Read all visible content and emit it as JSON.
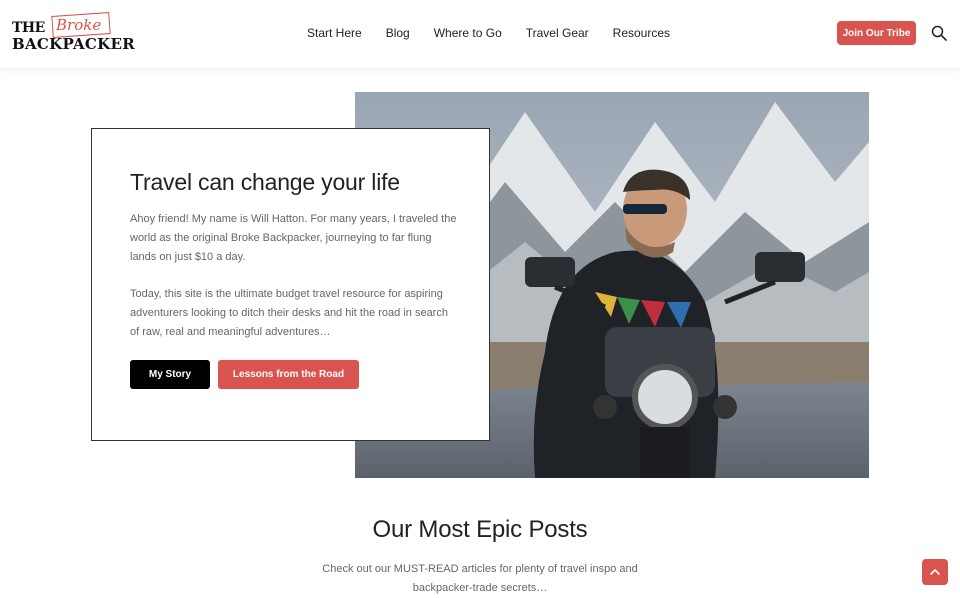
{
  "logo": {
    "line1": "THE",
    "line1_accent": "Broke",
    "line2": "BACKPACKER"
  },
  "nav": {
    "items": [
      "Start Here",
      "Blog",
      "Where to Go",
      "Travel Gear",
      "Resources"
    ]
  },
  "header": {
    "join_label": "Join Our Tribe"
  },
  "hero": {
    "title": "Travel can change your life",
    "paragraph1": "Ahoy friend! My name is Will Hatton. For many years, I traveled the world as the original Broke Backpacker, journeying to far flung lands on just $10 a day.",
    "paragraph2": "Today, this site is the ultimate budget travel resource for aspiring adventurers looking to ditch their desks and hit the road in search of raw, real and meaningful adventures…",
    "btn_story": "My Story",
    "btn_lessons": "Lessons from the Road"
  },
  "posts": {
    "title": "Our Most Epic Posts",
    "description": "Check out our MUST-READ articles for plenty of travel inspo and backpacker-trade secrets…"
  },
  "colors": {
    "accent": "#d9534f",
    "text": "#222222",
    "muted": "#666666"
  },
  "icons": {
    "search": "search-icon",
    "scroll_top": "chevron-up-icon"
  }
}
